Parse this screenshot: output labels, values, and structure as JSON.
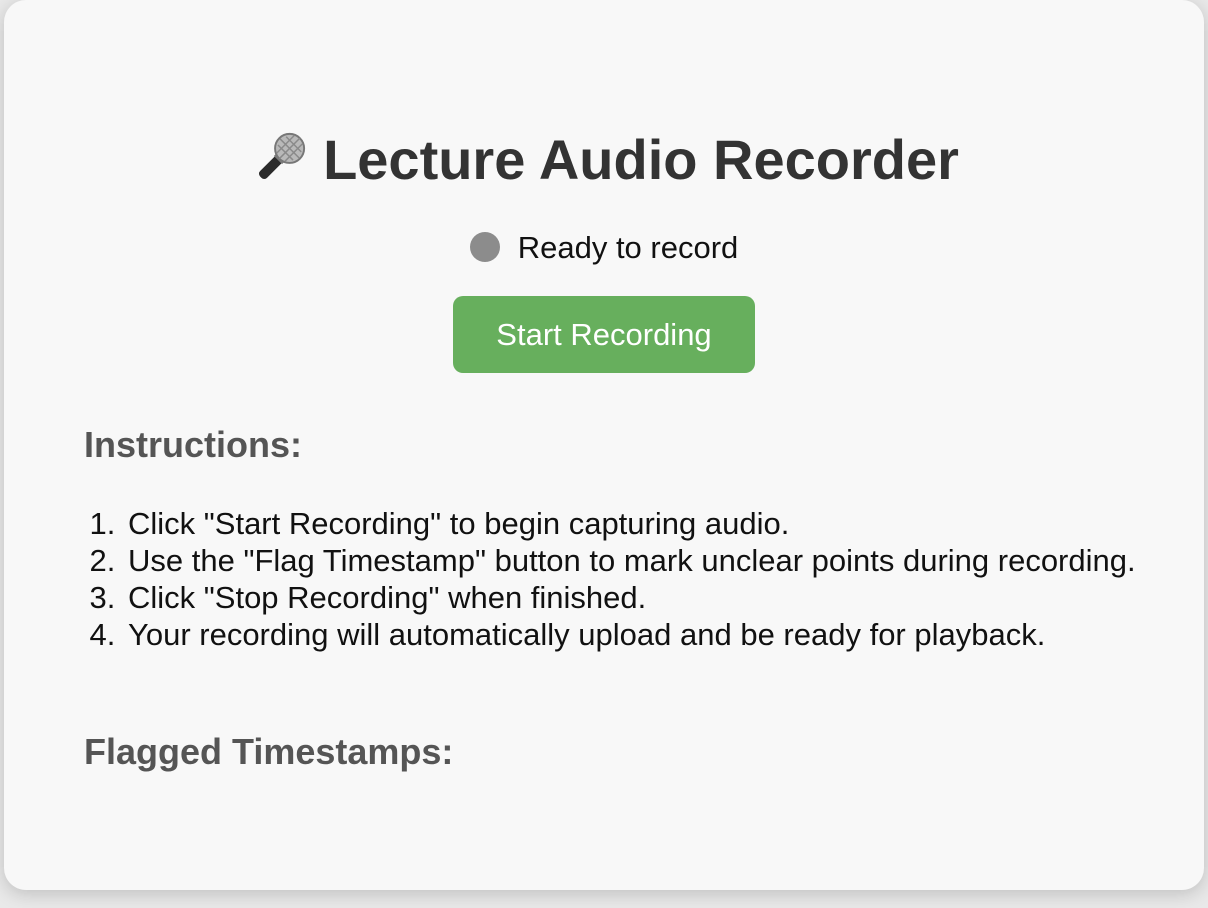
{
  "app": {
    "title": "Lecture Audio Recorder",
    "icon": "microphone-icon"
  },
  "status": {
    "text": "Ready to record",
    "indicator_color": "#8c8c8c"
  },
  "controls": {
    "start_label": "Start Recording",
    "start_color": "#67af5d"
  },
  "instructions": {
    "heading": "Instructions:",
    "steps": [
      "Click \"Start Recording\" to begin capturing audio.",
      "Use the \"Flag Timestamp\" button to mark unclear points during recording.",
      "Click \"Stop Recording\" when finished.",
      "Your recording will automatically upload and be ready for playback."
    ]
  },
  "flagged": {
    "heading": "Flagged Timestamps:",
    "items": []
  }
}
